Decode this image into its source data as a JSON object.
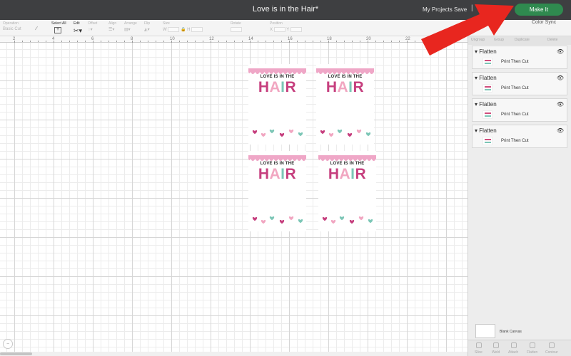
{
  "header": {
    "title": "Love is in the Hair*",
    "my_projects": "My Projects",
    "save": "Save",
    "more": "|",
    "make_it": "Make It"
  },
  "toolbar": {
    "operation_label": "Operation",
    "operation_value": "Basic Cut",
    "select_all": "Select All",
    "edit": "Edit",
    "offset": "Offset",
    "align": "Align",
    "arrange": "Arrange",
    "flip": "Flip",
    "size": "Size",
    "rotate": "Rotate",
    "position": "Position",
    "size_w": "W",
    "size_h": "H",
    "pos_x": "X",
    "pos_y": "Y",
    "color_sync": "Color Sync"
  },
  "ruler": {
    "ticks": [
      "2",
      "4",
      "6",
      "8",
      "10",
      "12",
      "14",
      "16",
      "18",
      "20",
      "22"
    ]
  },
  "cards": {
    "line1": "LOVE IS IN THE",
    "letters": [
      "H",
      "A",
      "I",
      "R"
    ],
    "colors": {
      "H": "#c63f7e",
      "A": "#f1a6c1",
      "I": "#7cc6b6",
      "R": "#c63f7e",
      "scallop": "#efa7c7"
    }
  },
  "panel": {
    "tools": [
      "Ungroup",
      "Group",
      "Duplicate",
      "Delete"
    ],
    "layers": [
      {
        "name": "Flatten",
        "sub": "Print Then Cut"
      },
      {
        "name": "Flatten",
        "sub": "Print Then Cut"
      },
      {
        "name": "Flatten",
        "sub": "Print Then Cut"
      },
      {
        "name": "Flatten",
        "sub": "Print Then Cut"
      }
    ],
    "blank_canvas": "Blank Canvas",
    "bottom_tools": [
      "Slice",
      "Weld",
      "Attach",
      "Flatten",
      "Contour"
    ]
  },
  "colors": {
    "accent_green": "#2f8a4f",
    "arrow_red": "#e8261f",
    "topbar": "#3e3f41"
  }
}
